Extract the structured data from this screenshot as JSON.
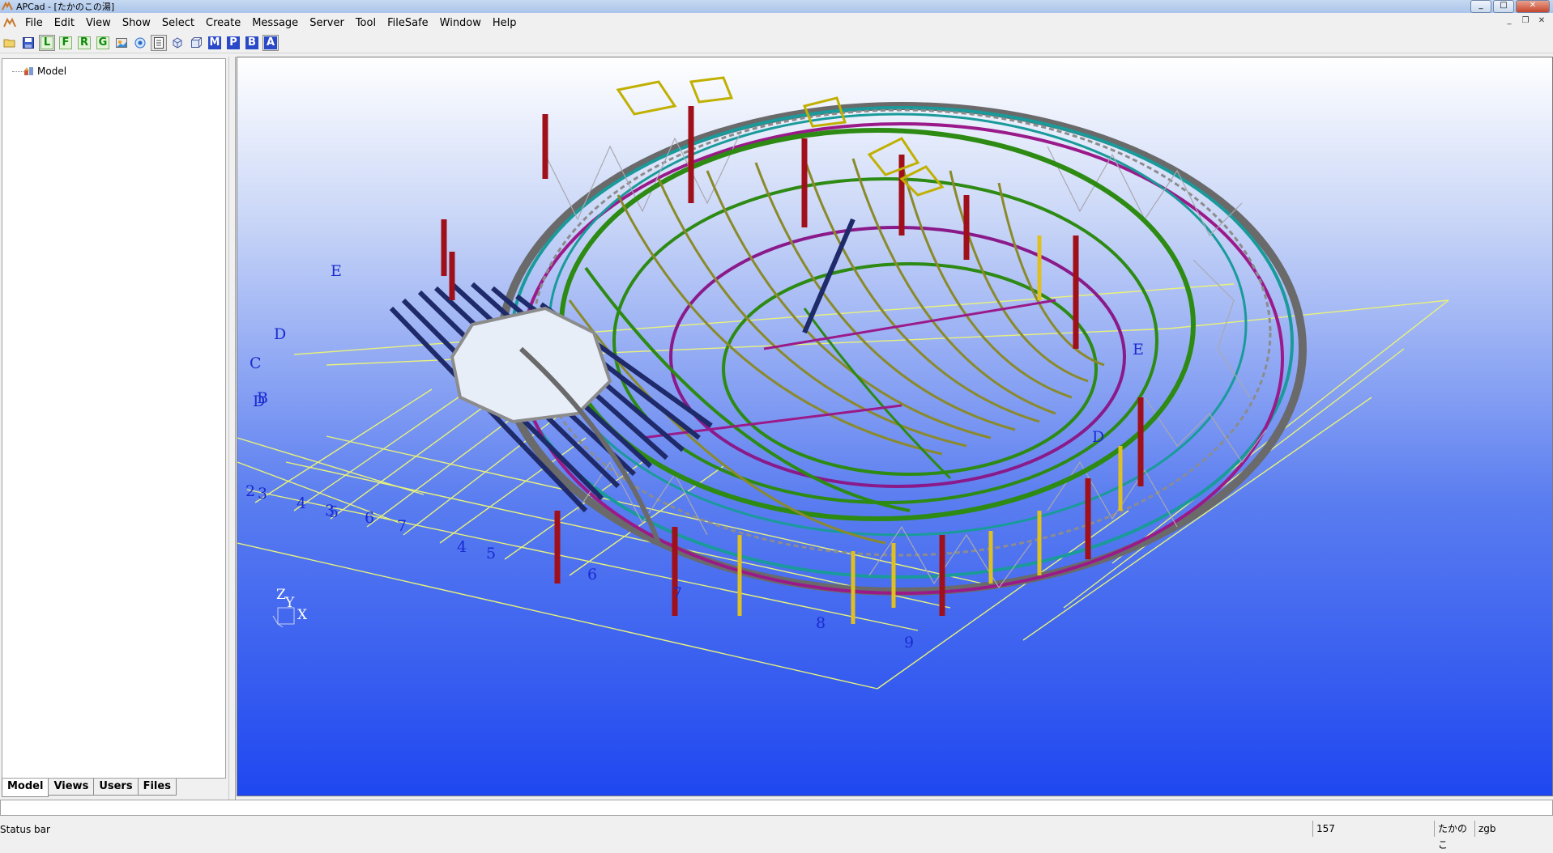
{
  "window": {
    "title": "APCad - [たかのこの湯]",
    "controls": [
      "_",
      "□",
      "✕"
    ]
  },
  "menubar": {
    "items": [
      "File",
      "Edit",
      "View",
      "Show",
      "Select",
      "Create",
      "Message",
      "Server",
      "Tool",
      "FileSafe",
      "Window",
      "Help"
    ],
    "mdi_controls": [
      "_",
      "❐",
      "✕"
    ]
  },
  "toolbar": {
    "buttons": [
      {
        "icon": "open-folder-icon"
      },
      {
        "icon": "save-icon"
      },
      {
        "icon": "letter-l-icon",
        "label": "L",
        "style": "green"
      },
      {
        "icon": "letter-f-icon",
        "label": "F",
        "style": "green"
      },
      {
        "icon": "letter-r-icon",
        "label": "R",
        "style": "green"
      },
      {
        "icon": "letter-g-icon",
        "label": "G",
        "style": "green"
      },
      {
        "icon": "image-view-icon"
      },
      {
        "icon": "target-icon"
      },
      {
        "icon": "document-list-icon"
      },
      {
        "icon": "cube-view-icon"
      },
      {
        "icon": "cube-3d-icon"
      },
      {
        "icon": "letter-m-icon",
        "label": "M",
        "style": "blue"
      },
      {
        "icon": "letter-p-icon",
        "label": "P",
        "style": "blue"
      },
      {
        "icon": "letter-b-icon",
        "label": "B",
        "style": "blue"
      },
      {
        "icon": "letter-a-icon",
        "label": "A",
        "style": "blue"
      }
    ]
  },
  "left_panel": {
    "tree_root": {
      "label": "Model",
      "icon": "model-icon"
    },
    "tabs": [
      "Model",
      "Views",
      "Users",
      "Files"
    ],
    "active_tab": "Model"
  },
  "viewport": {
    "grid_labels": {
      "letters": [
        "D",
        "C",
        "B",
        "D",
        "E",
        "E",
        "D"
      ],
      "numbers": [
        "2",
        "3",
        "4",
        "3",
        "5",
        "6",
        "7",
        "4",
        "5",
        "6",
        "7",
        "8",
        "9"
      ]
    },
    "axis": {
      "z": "Z",
      "y": "Y",
      "x": "X"
    },
    "colors": {
      "background_top": "#ffffff",
      "background_bottom": "#1f47f0",
      "grid": "#e8f27a",
      "label": "#1a2bd0",
      "column": "#a0101a",
      "beam_green": "#2d8a13",
      "beam_olive": "#8a8a2a",
      "ring_teal": "#1a9a9a",
      "ring_purple": "#9a1a8a",
      "beam_navy": "#1e2a6a",
      "steel_gray": "#8c8c8c"
    }
  },
  "statusbar": {
    "main": "Status bar",
    "count": "157",
    "project": "たかのこ",
    "user": "zgb"
  }
}
